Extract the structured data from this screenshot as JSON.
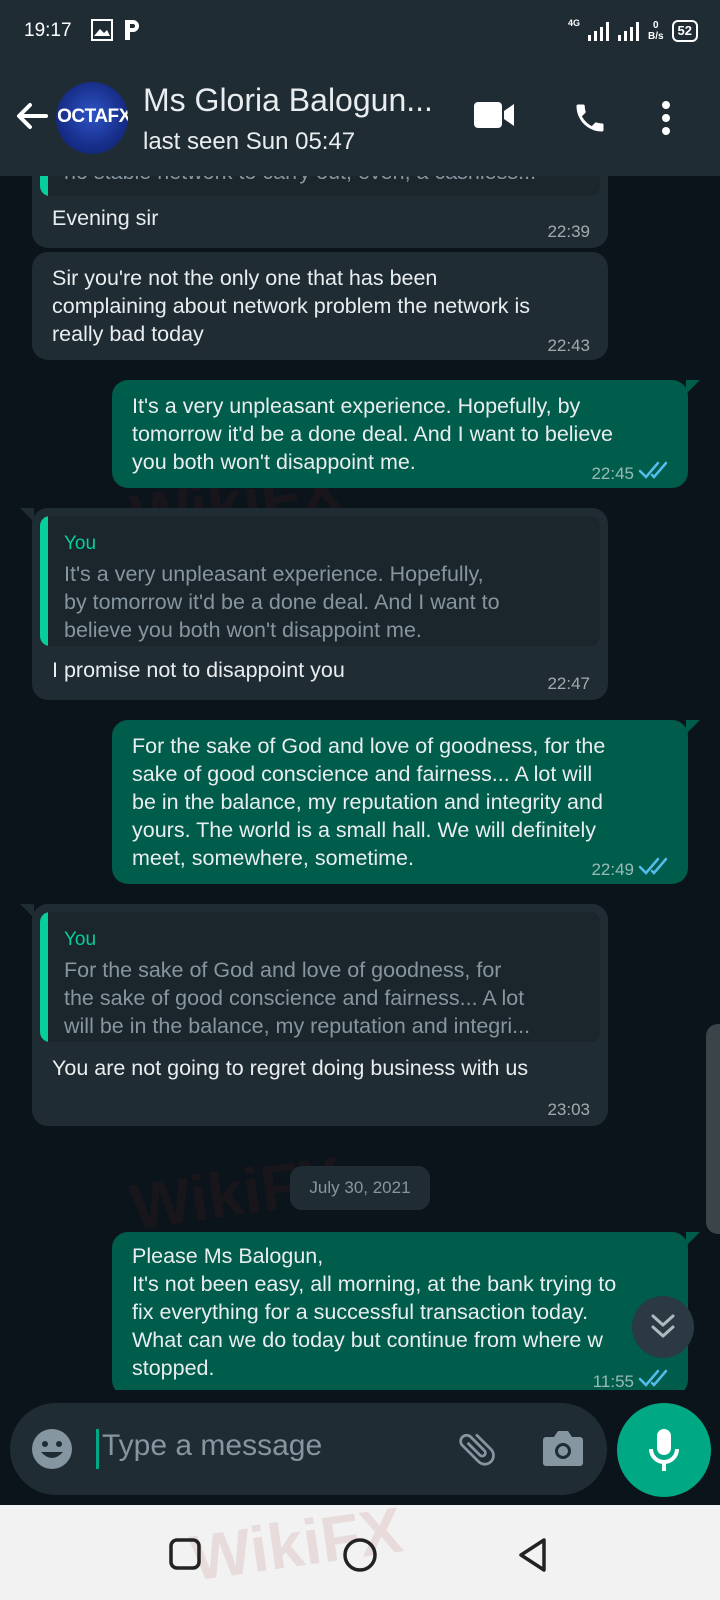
{
  "status_bar": {
    "time": "19:17",
    "network": "4G",
    "speed_value": "0",
    "speed_unit": "B/s",
    "battery": "52"
  },
  "header": {
    "contact_name": "Ms Gloria Balogun...",
    "avatar_text": "OCTAFX",
    "last_seen": "last seen Sun 05:47"
  },
  "messages": [
    {
      "dir": "in",
      "partial_text": "no stable network to carry out, even, a cashless...",
      "text": "Evening sir",
      "time": "22:39"
    },
    {
      "dir": "in",
      "text": "Sir you're not the only one that has been\ncomplaining about network problem the network is\nreally bad today",
      "time": "22:43"
    },
    {
      "dir": "out",
      "text": "It's a very unpleasant experience. Hopefully, by\ntomorrow it'd be a done deal. And I want to believe\nyou both won't disappoint me.",
      "time": "22:45",
      "status": "read"
    },
    {
      "dir": "in",
      "quote_author": "You",
      "quote_text": "It's a very unpleasant experience. Hopefully,\nby tomorrow it'd be a done deal. And I want to\nbelieve you both won't disappoint me.",
      "text": "I promise not to disappoint you",
      "time": "22:47"
    },
    {
      "dir": "out",
      "text": "For the sake of God and love of goodness, for the\nsake of good conscience and fairness... A lot will\nbe in the balance, my reputation and integrity and\nyours. The world is a small hall. We will definitely\nmeet, somewhere, sometime.",
      "time": "22:49",
      "status": "read"
    },
    {
      "dir": "in",
      "quote_author": "You",
      "quote_text": "For the sake of God and love of goodness, for\nthe sake of good conscience and fairness... A lot\nwill be in the balance, my reputation and integri...",
      "text": "You are not going to regret doing business with us",
      "time": "23:03"
    },
    {
      "dir": "out",
      "text": "Please Ms Balogun,\nIt's not been easy, all morning, at the bank trying to\nfix everything for a successful transaction today.\nWhat can we do today but continue from where w\nstopped.",
      "time": "11:55",
      "status": "read"
    }
  ],
  "date_separator": "July 30, 2021",
  "composer": {
    "placeholder": "Type a message"
  },
  "watermark": "WikiFX",
  "colors": {
    "background": "#0b141a",
    "bar": "#1f2c34",
    "incoming": "#1f2c34",
    "outgoing": "#005c4b",
    "accent": "#00a884",
    "read_tick": "#53bdeb"
  },
  "icons": [
    "back-arrow-icon",
    "video-call-icon",
    "phone-icon",
    "more-options-icon",
    "emoji-icon",
    "attach-icon",
    "camera-icon",
    "mic-icon",
    "scroll-down-icon",
    "read-ticks-icon"
  ]
}
